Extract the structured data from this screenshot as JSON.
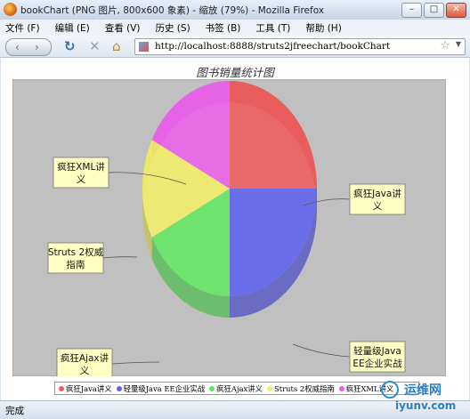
{
  "window": {
    "title": "bookChart (PNG 图片, 800x600 象素) - 缩放 (79%) - Mozilla Firefox",
    "buttons": {
      "minimize": "–",
      "maximize": "□",
      "close": "✕"
    }
  },
  "menu": [
    {
      "label": "文件 (F)"
    },
    {
      "label": "编辑 (E)"
    },
    {
      "label": "查看 (V)"
    },
    {
      "label": "历史 (S)"
    },
    {
      "label": "书签 (B)"
    },
    {
      "label": "工具 (T)"
    },
    {
      "label": "帮助 (H)"
    }
  ],
  "nav": {
    "back_icon": "‹",
    "forward_icon": "›",
    "reload_icon": "↻",
    "stop_icon": "✕",
    "home_icon": "⌂",
    "url": "http://localhost:8888/struts2jfreechart/bookChart",
    "star_icon": "☆",
    "dropdown_icon": "▼"
  },
  "chart_data": {
    "type": "pie",
    "title": "图书销量统计图",
    "slices": [
      {
        "label": "疯狂Java讲义",
        "callout": [
          "疯狂Java讲",
          "义"
        ],
        "value": 25,
        "color": "#ee5b5b"
      },
      {
        "label": "轻量级Java EE企业实战",
        "callout": [
          "轻量级Java",
          "EE企业实战"
        ],
        "value": 25,
        "color": "#5d62ee"
      },
      {
        "label": "疯狂Ajax讲义",
        "callout": [
          "疯狂Ajax讲",
          "义"
        ],
        "value": 17.5,
        "color": "#62e762"
      },
      {
        "label": "Struts 2权威指南",
        "callout": [
          "Struts 2权威",
          "指南"
        ],
        "value": 15,
        "color": "#f2ee66"
      },
      {
        "label": "疯狂XML讲义",
        "callout": [
          "疯狂XML讲",
          "义"
        ],
        "value": 17.5,
        "color": "#ea61ea"
      }
    ],
    "legend_position": "bottom",
    "plot_background": "#c0c0c0"
  },
  "status": {
    "text": "完成"
  },
  "watermark": {
    "cn": "运维网",
    "en": "iyunv.com"
  }
}
